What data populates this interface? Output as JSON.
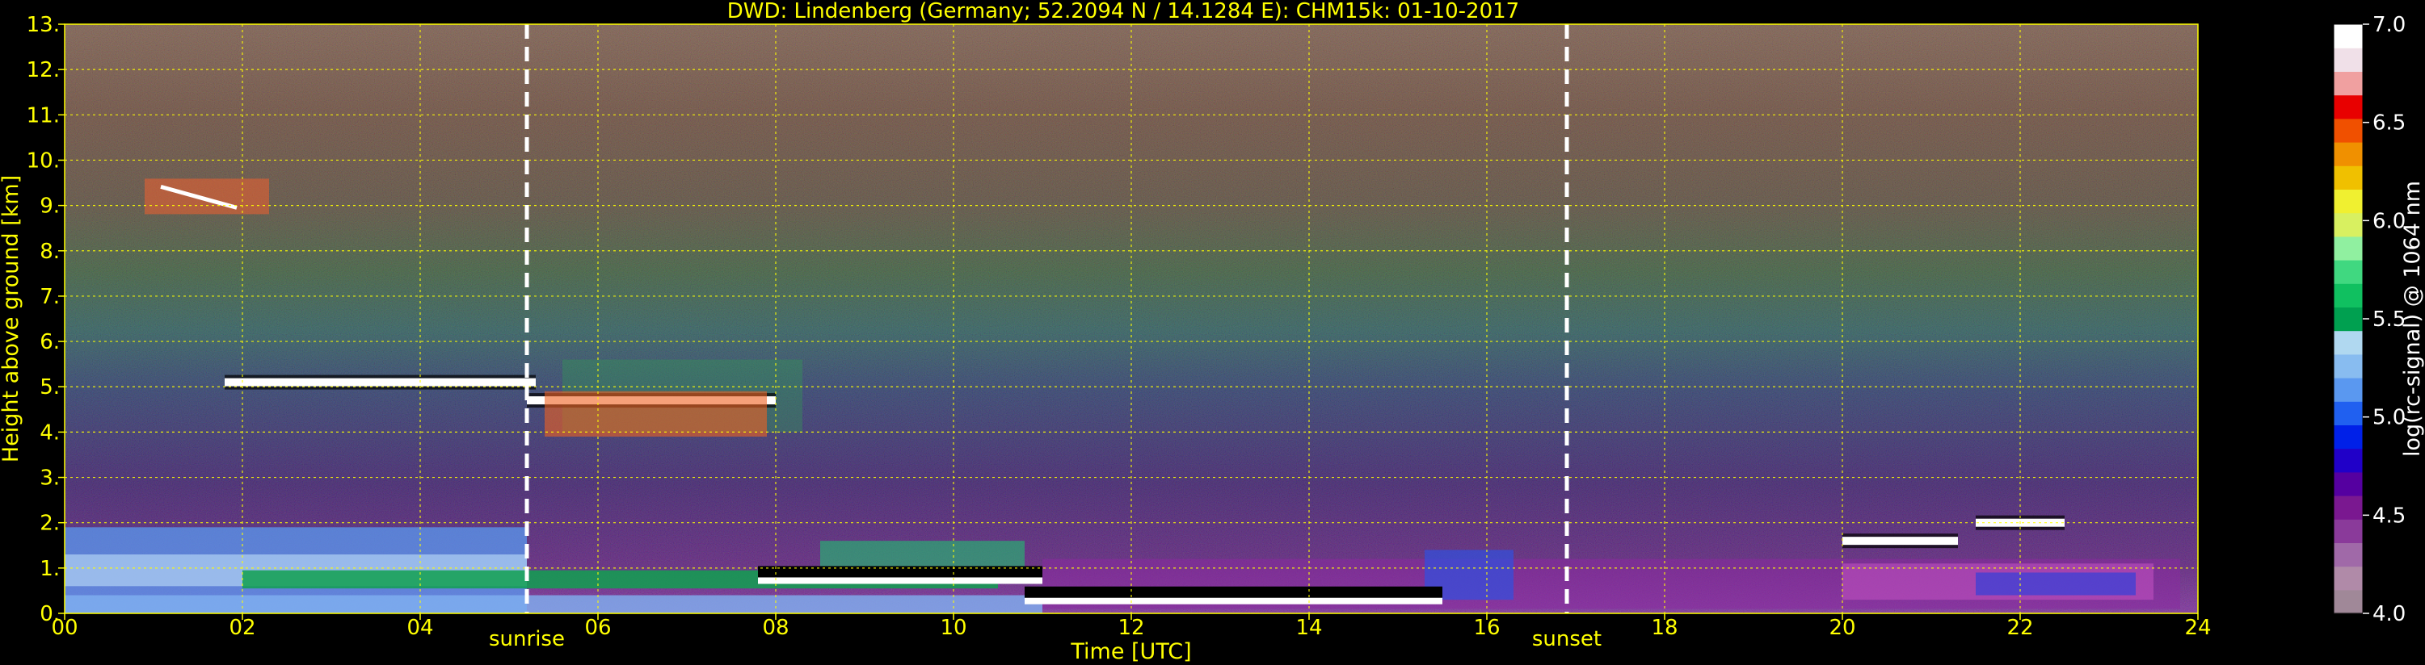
{
  "chart_data": {
    "type": "heatmap",
    "title": "DWD: Lindenberg (Germany; 52.2094 N / 14.1284 E):    CHM15k: 01-10-2017",
    "xlabel": "Time [UTC]",
    "ylabel": "Height above ground [km]",
    "xlim": [
      0,
      24
    ],
    "ylim": [
      0,
      13
    ],
    "x_ticks": [
      "00",
      "02",
      "04",
      "06",
      "08",
      "10",
      "12",
      "14",
      "16",
      "18",
      "20",
      "22",
      "24"
    ],
    "y_ticks": [
      "0.",
      "1.",
      "2.",
      "3.",
      "4.",
      "5.",
      "6.",
      "7.",
      "8.",
      "9.",
      "10.",
      "11.",
      "12.",
      "13."
    ],
    "grid": true,
    "colorbar": {
      "label": "log(rc-signal) @ 1064 nm",
      "range": [
        4.0,
        7.0
      ],
      "ticks": [
        "4.0",
        "4.5",
        "5.0",
        "5.5",
        "6.0",
        "6.5",
        "7.0"
      ],
      "colors": [
        "#a08898",
        "#b08aa8",
        "#a069a8",
        "#8a3a9a",
        "#7a1890",
        "#5500a0",
        "#2000c8",
        "#0020e8",
        "#2060f0",
        "#5a98f0",
        "#88bcf0",
        "#b0d8f0",
        "#00a050",
        "#10c060",
        "#40d880",
        "#90f0a0",
        "#d8f060",
        "#f0f030",
        "#f0c000",
        "#f09000",
        "#f05000",
        "#e80000",
        "#f0a0a0",
        "#f0e0e8",
        "#ffffff"
      ]
    },
    "annotations": [
      {
        "label": "sunrise",
        "x": 5.2
      },
      {
        "label": "sunset",
        "x": 16.9
      }
    ],
    "cloud_layers": [
      {
        "x_start": 0.9,
        "x_end": 2.3,
        "height_km": 9.2,
        "kind": "cirrus"
      },
      {
        "x_start": 1.8,
        "x_end": 5.3,
        "height_km": 5.1,
        "kind": "layer"
      },
      {
        "x_start": 5.2,
        "x_end": 8.0,
        "height_km": 4.7,
        "kind": "layer"
      },
      {
        "x_start": 7.8,
        "x_end": 11.0,
        "height_km": 0.9,
        "kind": "boundary layer top"
      },
      {
        "x_start": 10.8,
        "x_end": 15.5,
        "height_km": 0.45,
        "kind": "boundary layer top"
      },
      {
        "x_start": 20.0,
        "x_end": 21.3,
        "height_km": 1.6,
        "kind": "layer"
      },
      {
        "x_start": 21.5,
        "x_end": 22.5,
        "height_km": 2.0,
        "kind": "layer"
      }
    ]
  }
}
